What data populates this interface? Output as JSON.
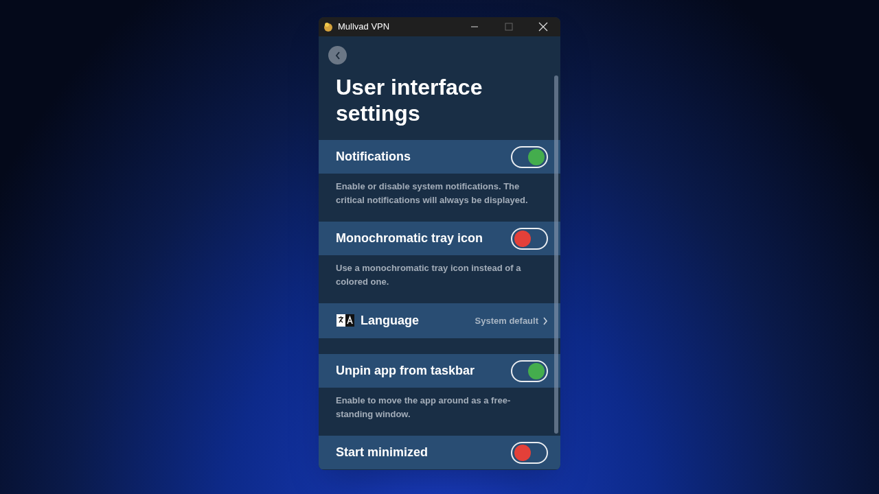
{
  "window": {
    "title": "Mullvad VPN"
  },
  "page": {
    "title": "User interface settings"
  },
  "settings": [
    {
      "kind": "toggle",
      "label": "Notifications",
      "on": true,
      "description": "Enable or disable system notifications. The critical notifications will always be displayed."
    },
    {
      "kind": "toggle",
      "label": "Monochromatic tray icon",
      "on": false,
      "description": "Use a monochromatic tray icon instead of a colored one."
    },
    {
      "kind": "link",
      "label": "Language",
      "value": "System default"
    },
    {
      "kind": "toggle",
      "label": "Unpin app from taskbar",
      "on": true,
      "description": "Enable to move the app around as a free-standing window."
    },
    {
      "kind": "toggle",
      "label": "Start minimized",
      "on": false
    }
  ]
}
